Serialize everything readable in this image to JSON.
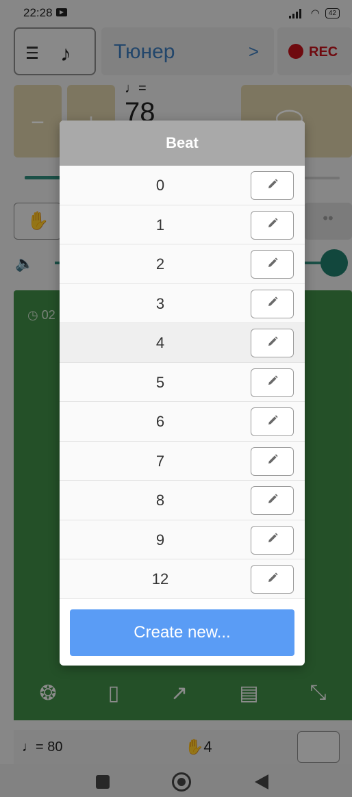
{
  "status": {
    "time": "22:28",
    "battery": "42"
  },
  "topbar": {
    "title": "Тюнер",
    "chevron": ">",
    "rec_label": "REC"
  },
  "tempo": {
    "note_eq": "♩=",
    "value_partial": "78",
    "minus": "−",
    "plus": "+"
  },
  "green_panel": {
    "timer_partial": "02"
  },
  "bottom_info": {
    "bpm": "♩= 80",
    "count": "4"
  },
  "dialog": {
    "title": "Beat",
    "items": [
      {
        "label": "0"
      },
      {
        "label": "1"
      },
      {
        "label": "2"
      },
      {
        "label": "3"
      },
      {
        "label": "4"
      },
      {
        "label": "5"
      },
      {
        "label": "6"
      },
      {
        "label": "7"
      },
      {
        "label": "8"
      },
      {
        "label": "9"
      },
      {
        "label": "12"
      }
    ],
    "selected_index": 4,
    "create_label": "Create new..."
  },
  "colors": {
    "accent_blue": "#5a9cf5",
    "header_gray": "#a9a9a9",
    "rec_red": "#c0121a",
    "panel_green": "#3f8a45",
    "teal": "#2f8a7a"
  }
}
